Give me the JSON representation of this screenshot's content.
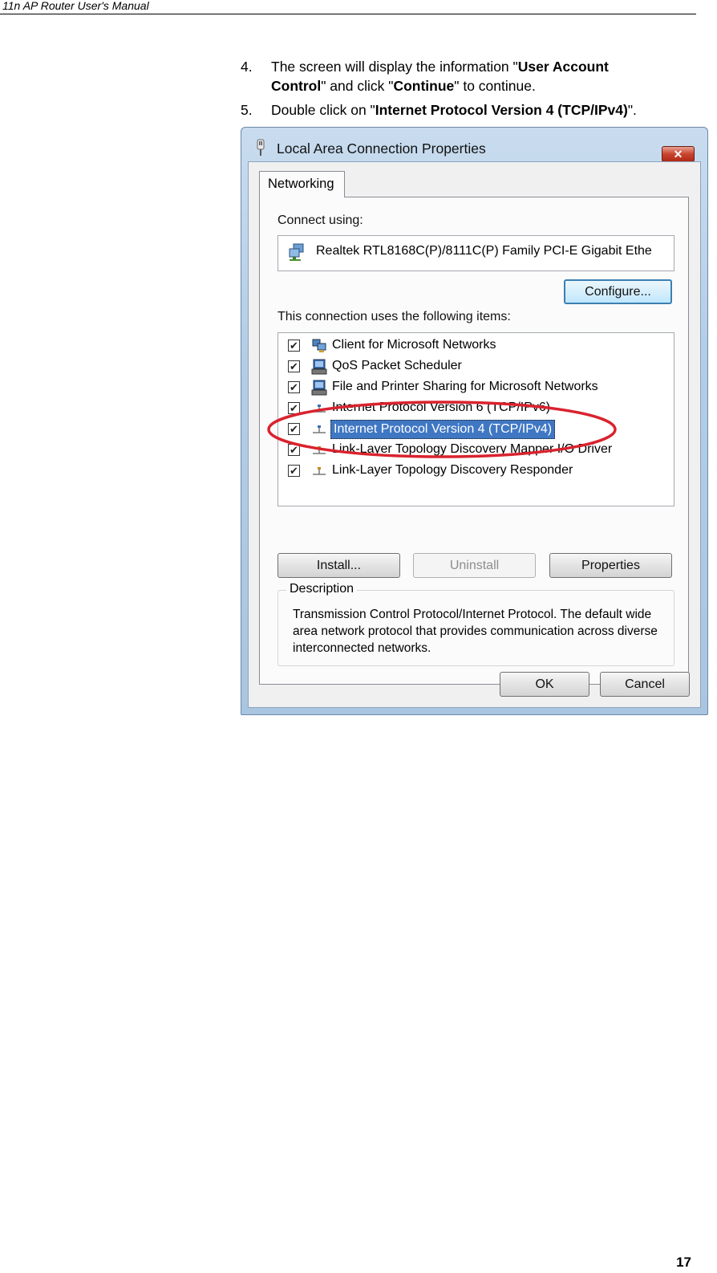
{
  "header": {
    "title": "11n AP Router User's Manual"
  },
  "steps": [
    {
      "num": "4.",
      "line1_pre": "The screen will display the information \"",
      "line1_bold": "User Account",
      "line2_bold": "Control",
      "line2_mid": "\" and click \"",
      "line2_bold2": "Continue",
      "line2_post": "\" to continue."
    },
    {
      "num": "5.",
      "pre": "Double click on \"",
      "bold": "Internet Protocol Version 4 (TCP/IPv4)",
      "post": "\"."
    }
  ],
  "dialog": {
    "title": "Local Area Connection Properties",
    "close_label": "✕",
    "tab": "Networking",
    "connect_using_label": "Connect using:",
    "adapter": "Realtek RTL8168C(P)/8111C(P) Family PCI-E Gigabit Ethe",
    "configure_label": "Configure...",
    "items_label": "This connection uses the following items:",
    "items": [
      {
        "label": "Client for Microsoft Networks",
        "checked": true,
        "icon": "network-client-icon"
      },
      {
        "label": "QoS Packet Scheduler",
        "checked": true,
        "icon": "service-icon"
      },
      {
        "label": "File and Printer Sharing for Microsoft Networks",
        "checked": true,
        "icon": "service-icon"
      },
      {
        "label": "Internet Protocol Version 6 (TCP/IPv6)",
        "checked": true,
        "icon": "protocol-icon"
      },
      {
        "label": "Internet Protocol Version 4 (TCP/IPv4)",
        "checked": true,
        "icon": "protocol-icon",
        "selected": true
      },
      {
        "label": "Link-Layer Topology Discovery Mapper I/O Driver",
        "checked": true,
        "icon": "protocol-icon"
      },
      {
        "label": "Link-Layer Topology Discovery Responder",
        "checked": true,
        "icon": "protocol-icon"
      }
    ],
    "install_label": "Install...",
    "uninstall_label": "Uninstall",
    "properties_label": "Properties",
    "description_legend": "Description",
    "description_text": "Transmission Control Protocol/Internet Protocol. The default wide area network protocol that provides communication across diverse interconnected networks.",
    "ok_label": "OK",
    "cancel_label": "Cancel",
    "check_glyph": "✔",
    "highlight_color": "#d9232e"
  },
  "page_number": "17"
}
